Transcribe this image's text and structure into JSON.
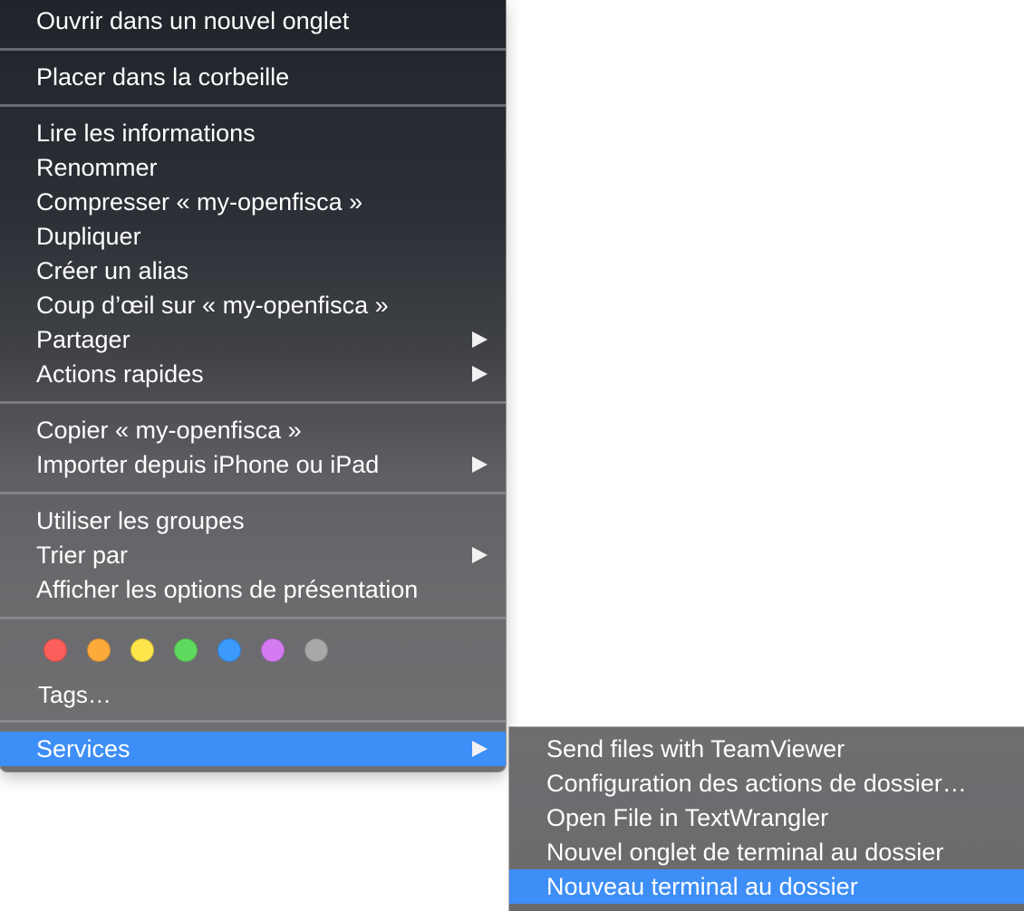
{
  "menu": {
    "items": [
      {
        "label": "Ouvrir dans un nouvel onglet"
      },
      {
        "label": "Placer dans la corbeille"
      },
      {
        "label": "Lire les informations"
      },
      {
        "label": "Renommer"
      },
      {
        "label": "Compresser « my-openfisca »"
      },
      {
        "label": "Dupliquer"
      },
      {
        "label": "Créer un alias"
      },
      {
        "label": "Coup d’œil sur « my-openfisca »"
      },
      {
        "label": "Partager"
      },
      {
        "label": "Actions rapides"
      },
      {
        "label": "Copier « my-openfisca »"
      },
      {
        "label": "Importer depuis iPhone ou iPad"
      },
      {
        "label": "Utiliser les groupes"
      },
      {
        "label": "Trier par"
      },
      {
        "label": "Afficher les options de présentation"
      },
      {
        "label": "Services"
      }
    ],
    "tags_label": "Tags…",
    "tag_colors": [
      "#fc5f5b",
      "#fcaa3a",
      "#fde54a",
      "#5fda5f",
      "#3b9afb",
      "#d57bf2",
      "#a8a8aa"
    ]
  },
  "submenu": {
    "items": [
      {
        "label": "Send files with TeamViewer"
      },
      {
        "label": "Configuration des actions de dossier…"
      },
      {
        "label": "Open File in TextWrangler"
      },
      {
        "label": "Nouvel onglet de terminal au dossier"
      },
      {
        "label": "Nouveau terminal au dossier"
      }
    ]
  },
  "colors": {
    "highlight": "#3d8ef6",
    "text": "#ffffff"
  }
}
